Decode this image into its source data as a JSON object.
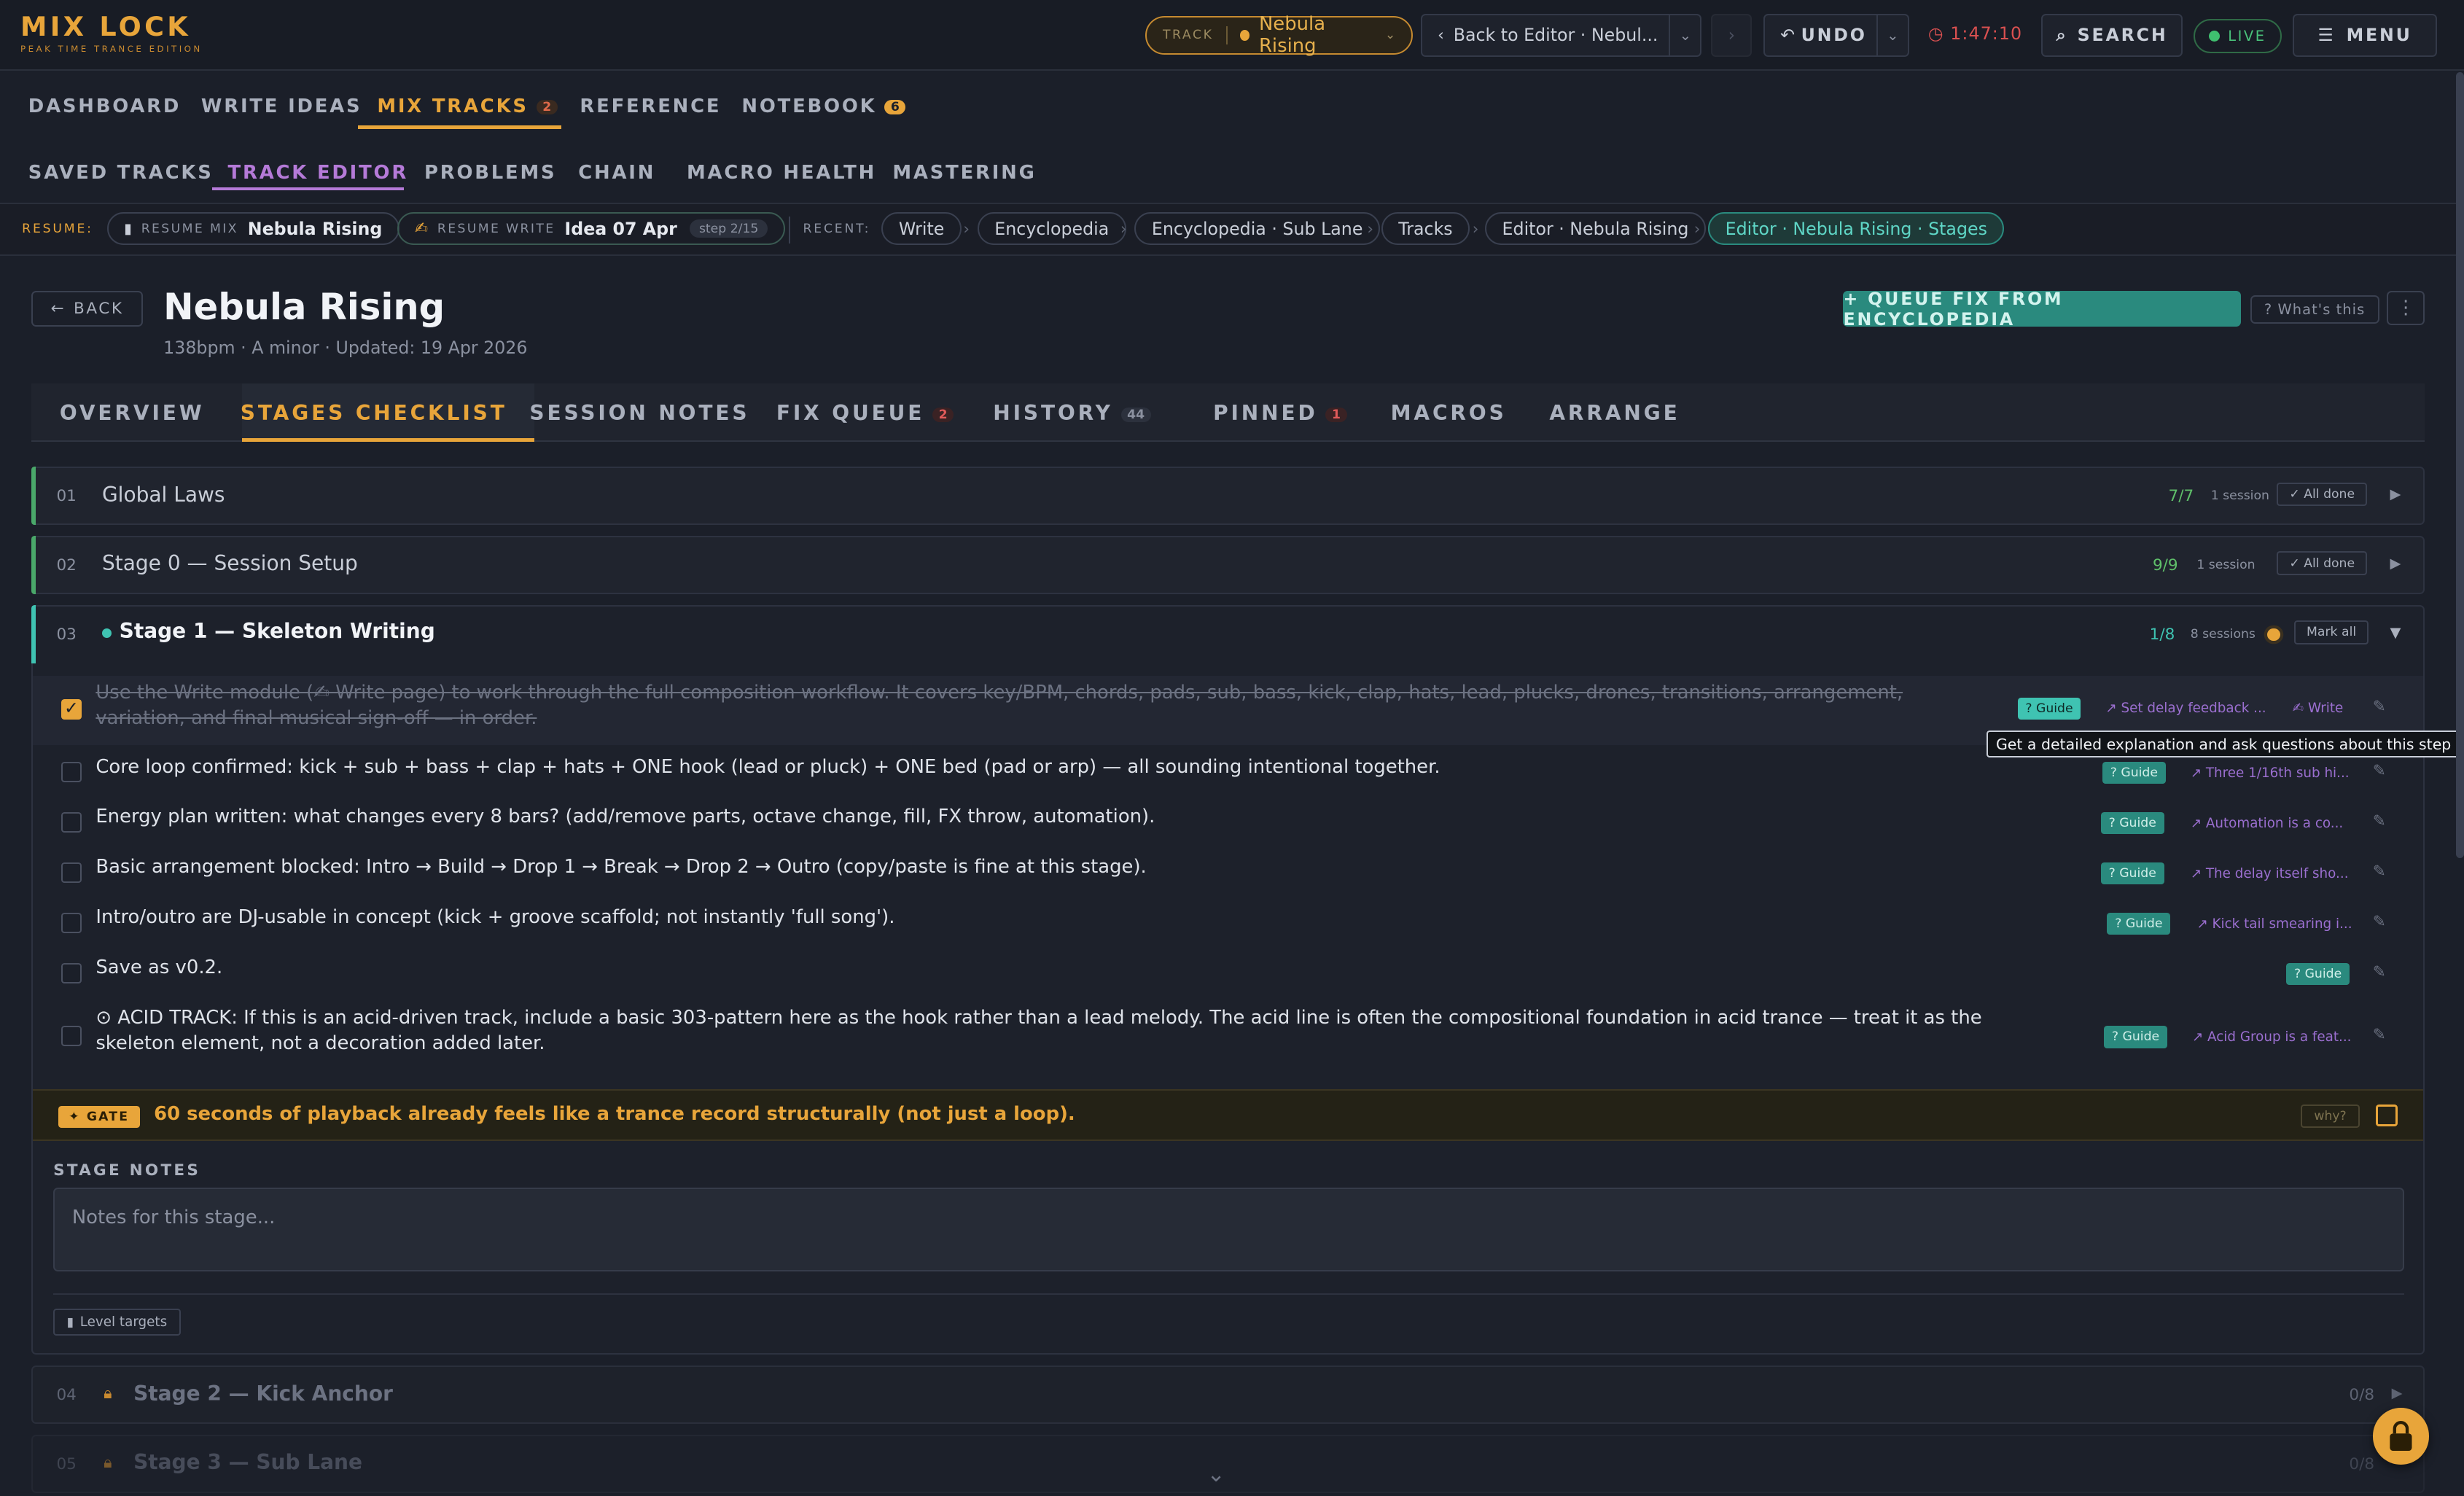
{
  "app": {
    "logo_main": "MIX LOCK",
    "logo_sub": "PEAK TIME TRANCE EDITION"
  },
  "topbar": {
    "track_key": "TRACK",
    "track_name": "Nebula Rising",
    "back_label": "Back to Editor · Nebul...",
    "undo_label": "UNDO",
    "timer": "1:47:10",
    "search_label": "SEARCH",
    "live_label": "LIVE",
    "menu_label": "MENU"
  },
  "nav_main": [
    {
      "label": "DASHBOARD"
    },
    {
      "label": "WRITE IDEAS"
    },
    {
      "label": "MIX TRACKS",
      "badge": "2",
      "active": true
    },
    {
      "label": "REFERENCE"
    },
    {
      "label": "NOTEBOOK",
      "badge": "6"
    }
  ],
  "nav_sub": [
    {
      "label": "SAVED TRACKS"
    },
    {
      "label": "TRACK EDITOR",
      "active": true
    },
    {
      "label": "PROBLEMS"
    },
    {
      "label": "CHAIN"
    },
    {
      "label": "MACRO HEALTH"
    },
    {
      "label": "MASTERING"
    }
  ],
  "resume": {
    "label": "RESUME:",
    "mix_key": "RESUME MIX",
    "mix_name": "Nebula Rising",
    "write_key": "RESUME WRITE",
    "write_name": "Idea 07 Apr",
    "write_step": "step 2/15",
    "recent_label": "RECENT:",
    "recent": [
      "Write",
      "Encyclopedia",
      "Encyclopedia · Sub Lane",
      "Tracks",
      "Editor · Nebula Rising",
      "Editor · Nebula Rising · Stages"
    ]
  },
  "header": {
    "back_label": "BACK",
    "title": "Nebula Rising",
    "subtitle": "138bpm · A minor · Updated: 19 Apr 2026",
    "queue_label": "+ QUEUE FIX FROM ENCYCLOPEDIA",
    "whats_label": "? What's this"
  },
  "tabs": [
    {
      "label": "OVERVIEW"
    },
    {
      "label": "STAGES CHECKLIST",
      "active": true
    },
    {
      "label": "SESSION NOTES"
    },
    {
      "label": "FIX QUEUE",
      "badge": "2"
    },
    {
      "label": "HISTORY",
      "badge": "44"
    },
    {
      "label": "PINNED",
      "badge": "1"
    },
    {
      "label": "MACROS"
    },
    {
      "label": "ARRANGE"
    }
  ],
  "stages": [
    {
      "num": "01",
      "name": "Global Laws",
      "count": "7/7",
      "sessions": "1 session",
      "button": "✓ All done"
    },
    {
      "num": "02",
      "name": "Stage 0 — Session Setup",
      "count": "9/9",
      "sessions": "1 session",
      "button": "✓ All done"
    },
    {
      "num": "03",
      "name": "Stage 1 — Skeleton Writing",
      "count": "1/8",
      "sessions": "8 sessions",
      "button": "Mark all"
    }
  ],
  "checklist": [
    {
      "text": "Use the Write module (✍ Write page) to work through the full composition workflow. It covers key/BPM, chords, pads, sub, bass, kick, clap, hats, lead, plucks, drones, transitions, arrangement, variation, and final musical sign-off — in order.",
      "done": true,
      "guide": "? Guide",
      "ref": "↗ Set delay feedback ...",
      "ref2": "✍ Write"
    },
    {
      "text": "Core loop confirmed: kick + sub + bass + clap + hats + ONE hook (lead or pluck) + ONE bed (pad or arp) — all sounding intentional together.",
      "done": false,
      "guide": "? Guide",
      "ref": "↗ Three 1/16th sub hi..."
    },
    {
      "text": "Energy plan written: what changes every 8 bars? (add/remove parts, octave change, fill, FX throw, automation).",
      "done": false,
      "guide": "? Guide",
      "ref": "↗ Automation is a co..."
    },
    {
      "text": "Basic arrangement blocked: Intro → Build → Drop 1 → Break → Drop 2 → Outro (copy/paste is fine at this stage).",
      "done": false,
      "guide": "? Guide",
      "ref": "↗ The delay itself sho..."
    },
    {
      "text": "Intro/outro are DJ-usable in concept (kick + groove scaffold; not instantly 'full song').",
      "done": false,
      "guide": "? Guide",
      "ref": "↗ Kick tail smearing i..."
    },
    {
      "text": "Save as v0.2.",
      "done": false,
      "guide": "? Guide",
      "ref": ""
    },
    {
      "text": "⊙ ACID TRACK: If this is an acid-driven track, include a basic 303-pattern here as the hook rather than a lead melody. The acid line is often the compositional foundation in acid trance — treat it as the skeleton element, not a decoration added later.",
      "done": false,
      "guide": "? Guide",
      "ref": "↗ Acid Group is a feat..."
    }
  ],
  "tooltip": "Get a detailed explanation and ask questions about this step",
  "gate": {
    "badge": "✦ GATE",
    "text": "60 seconds of playback already feels like a trance record structurally (not just a loop).",
    "why": "why?"
  },
  "stage_notes": {
    "label": "STAGE NOTES",
    "placeholder": "Notes for this stage...",
    "level_targets": "Level targets"
  },
  "locked_stages": [
    {
      "num": "04",
      "name": "Stage 2 — Kick Anchor",
      "count": "0/8"
    },
    {
      "num": "05",
      "name": "Stage 3 — Sub Lane",
      "count": "0/8"
    }
  ],
  "colors": {
    "accent": "#e8a53a",
    "teal": "#2a8a7e",
    "purple": "#b57ad8",
    "bg": "#1b1f29"
  }
}
